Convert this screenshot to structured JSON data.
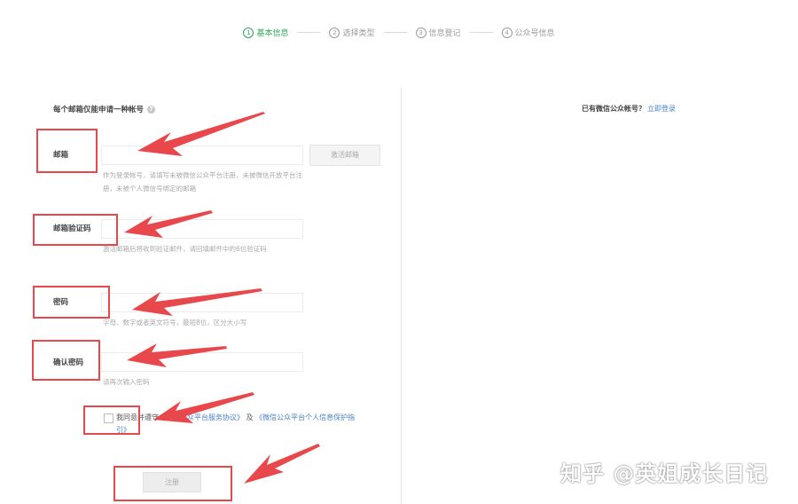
{
  "steps": [
    {
      "num": "1",
      "label": "基本信息",
      "active": true
    },
    {
      "num": "2",
      "label": "选择类型",
      "active": false
    },
    {
      "num": "3",
      "label": "信息登记",
      "active": false
    },
    {
      "num": "4",
      "label": "公众号信息",
      "active": false
    }
  ],
  "form": {
    "hint": "每个邮箱仅能申请一种帐号",
    "email_label": "邮箱",
    "email_value": "",
    "activate_button": "激活邮箱",
    "email_help": "作为登录帐号，请填写未被微信公众平台注册，未被微信开放平台注册，未被个人微信号绑定的邮箱",
    "code_label": "邮箱验证码",
    "code_value": "",
    "code_help": "激活邮箱后将收到验证邮件，请回填邮件中的6位验证码",
    "password_label": "密码",
    "password_value": "",
    "password_help": "字母、数字或者英文符号，最短8位，区分大小写",
    "confirm_label": "确认密码",
    "confirm_value": "",
    "confirm_help": "请再次输入密码",
    "agree_prefix": "我同意并遵守",
    "agree_link1": "《微信公众平台服务协议》",
    "agree_and": "及",
    "agree_link2": "《微信公众平台个人信息保护指引》",
    "submit_label": "注册"
  },
  "side": {
    "login_prompt": "已有微信公众帐号？",
    "login_link": "立即登录"
  },
  "watermark": "知乎 @英姐成长日记",
  "colors": {
    "active_step": "#2ea55a",
    "annotation": "#e8484b",
    "link": "#4a7fc1"
  }
}
